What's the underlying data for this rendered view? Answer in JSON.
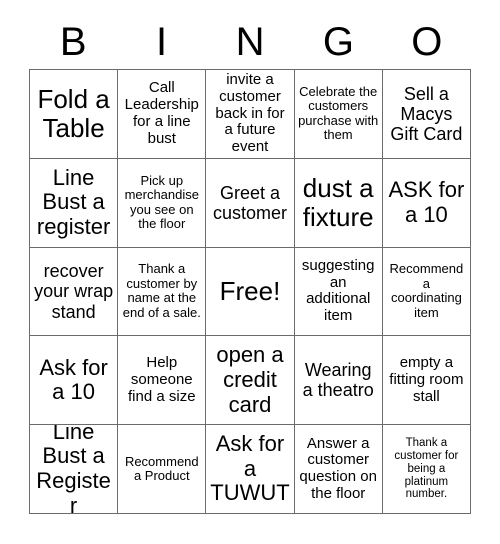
{
  "header": {
    "letters": [
      "B",
      "I",
      "N",
      "G",
      "O"
    ]
  },
  "grid": {
    "rows": 5,
    "columns": 5,
    "border_color": "#6b6b6b",
    "background_color": "#ffffff",
    "text_color": "#000000",
    "cells": [
      [
        {
          "text": "Fold a Table",
          "size": "t-xl"
        },
        {
          "text": "Call Leadership for a line bust",
          "size": "t-sm"
        },
        {
          "text": "invite a customer back in for a future event",
          "size": "t-sm"
        },
        {
          "text": "Celebrate the customers purchase with them",
          "size": "t-xs"
        },
        {
          "text": "Sell a Macys Gift Card",
          "size": "t-md"
        }
      ],
      [
        {
          "text": "Line Bust a register",
          "size": "t-lg"
        },
        {
          "text": "Pick up merchandise you see on the floor",
          "size": "t-xs"
        },
        {
          "text": "Greet a customer",
          "size": "t-md"
        },
        {
          "text": "dust a fixture",
          "size": "t-xl"
        },
        {
          "text": "ASK for a 10",
          "size": "t-lg"
        }
      ],
      [
        {
          "text": "recover your wrap stand",
          "size": "t-md"
        },
        {
          "text": "Thank a customer by name at the end of a sale.",
          "size": "t-xs"
        },
        {
          "text": "Free!",
          "size": "t-xl"
        },
        {
          "text": "suggesting an additional item",
          "size": "t-sm"
        },
        {
          "text": "Recommend a coordinating item",
          "size": "t-xs"
        }
      ],
      [
        {
          "text": "Ask for a 10",
          "size": "t-lg"
        },
        {
          "text": "Help someone find a size",
          "size": "t-sm"
        },
        {
          "text": "open a credit card",
          "size": "t-lg"
        },
        {
          "text": "Wearing a theatro",
          "size": "t-md"
        },
        {
          "text": "empty a fitting room stall",
          "size": "t-sm"
        }
      ],
      [
        {
          "text": "Line Bust a Register",
          "size": "t-lg"
        },
        {
          "text": "Recommend a Product",
          "size": "t-xs"
        },
        {
          "text": "Ask for a TUWUT",
          "size": "t-lg"
        },
        {
          "text": "Answer a customer question on the floor",
          "size": "t-sm"
        },
        {
          "text": "Thank a customer for being a platinum number.",
          "size": "t-xxs"
        }
      ]
    ]
  }
}
